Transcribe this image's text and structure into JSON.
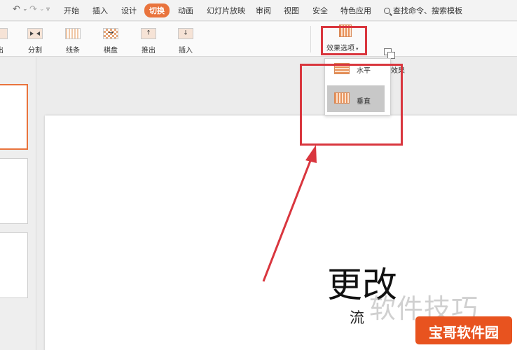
{
  "quick_access": {
    "undo": "↶",
    "undo_drop": "⌄",
    "redo": "↷",
    "redo_drop": "⌄",
    "more": "▿"
  },
  "menu": {
    "items": [
      "开始",
      "插入",
      "设计",
      "切换",
      "动画",
      "幻灯片放映",
      "审阅",
      "视图",
      "安全",
      "特色应用"
    ],
    "active_index": 3,
    "search": "查找命令、搜索模板"
  },
  "ribbon": {
    "buttons": [
      "出",
      "分割",
      "线条",
      "棋盘",
      "推出",
      "插入"
    ],
    "effect_options": "效果选项",
    "switch_effect": "切换效果"
  },
  "dropdown": {
    "horizontal": "水平",
    "vertical": "垂直"
  },
  "slide": {
    "title": "更改",
    "subtitle": "流"
  },
  "watermark": {
    "text": "软件技巧",
    "badge": "宝哥软件园"
  },
  "colors": {
    "accent": "#e9743d",
    "highlight_box": "#d9363e",
    "badge": "#e8531f"
  },
  "icons": {
    "undo": "undo-icon",
    "redo": "redo-icon",
    "search": "search-icon",
    "vertical_effect": "vertical-stripes-icon",
    "horizontal_effect": "horizontal-stripes-icon"
  }
}
